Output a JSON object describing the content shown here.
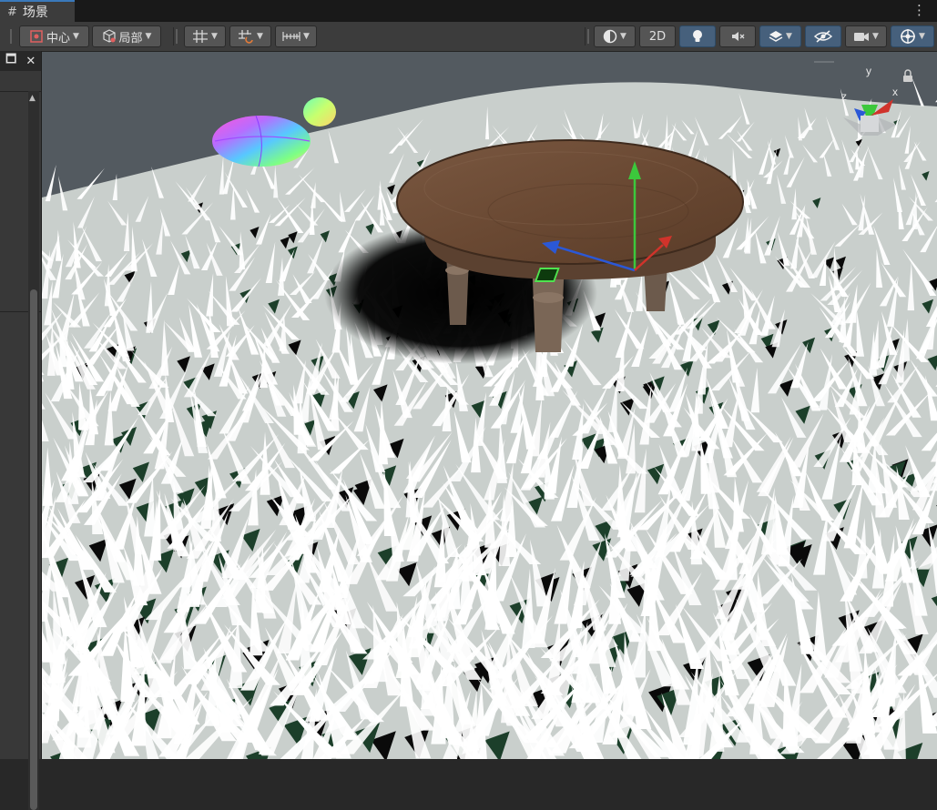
{
  "window": {
    "tab_title": "场景",
    "tab_icon": "hash-grid-icon",
    "menu_icon": "kebab-menu-icon"
  },
  "toolbar": {
    "pivot_label": "中心",
    "space_label": "局部",
    "mode_2d_label": "2D",
    "pivot_icon": "pivot-center-icon",
    "space_icon": "cube-local-icon",
    "grid_snap_icon": "grid-snap-icon",
    "increment_snap_icon": "increment-snap-icon",
    "ruler_icon": "ruler-icon",
    "shading_icon": "shading-mode-icon",
    "lighting_icon": "lightbulb-icon",
    "audio_icon": "audio-mute-icon",
    "effects_icon": "effects-layers-icon",
    "visibility_icon": "hidden-eye-icon",
    "camera_icon": "camera-icon",
    "gizmos_icon": "gizmos-icon"
  },
  "left_panel": {
    "restore_icon": "window-restore-icon",
    "close_icon": "close-icon"
  },
  "scene": {
    "gizmo_axes": {
      "y": "y",
      "x": "x",
      "z": "z"
    },
    "lock_icon": "lock-icon",
    "colors": {
      "sky": "#535a60",
      "grass_blade": "#ffffff",
      "grass_ground": "#1c3f2a",
      "table_top": "#6b4a33",
      "x_axis": "#d0332b",
      "y_axis": "#3cc83c",
      "z_axis": "#2b58d6"
    }
  }
}
